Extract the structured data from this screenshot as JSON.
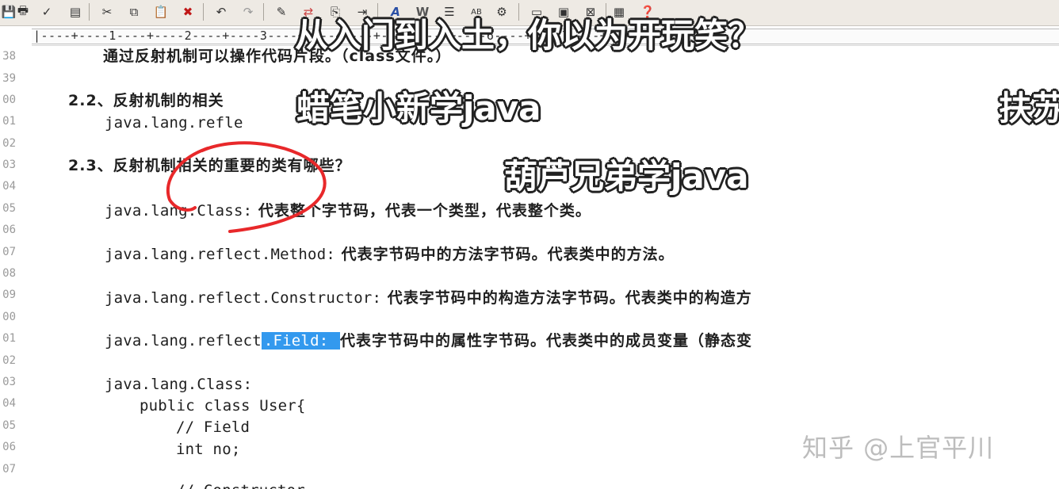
{
  "ruler": {
    "marks": "|----+----1----+----2----+----3----+----4----+----5----+----6----+----7----+----8----+----"
  },
  "line_numbers": [
    "38",
    "39",
    "00",
    "01",
    "02",
    "03",
    "04",
    "05",
    "06",
    "07",
    "08",
    "09",
    "00",
    "01",
    "02",
    "03",
    "04",
    "05",
    "06",
    "07"
  ],
  "document": {
    "line_38": "通过反射机制可以操作代码片段。（class文件。）",
    "line_00": "2.2、反射机制的相关",
    "line_01": "java.lang.refle",
    "line_03": "2.3、反射机制相关的重要的类有哪些？",
    "class_code": "java.lang.Class:",
    "class_desc": " 代表整个字节码，代表一个类型，代表整个类。",
    "method_code": "java.lang.reflect.Method:",
    "method_desc": " 代表字节码中的方法字节码。代表类中的方法。",
    "constructor_code": "java.lang.reflect.Constructor:",
    "constructor_desc": " 代表字节码中的构造方法字节码。代表类中的构造方",
    "field_prefix": "java.lang.reflect",
    "field_selected": ".Field: ",
    "field_desc": "代表字节码中的属性字节码。代表类中的成员变量（静态变",
    "code_1": "java.lang.Class:",
    "code_2": "public class User{",
    "code_3": "// Field",
    "code_4": "int no;",
    "code_5": "// Constructor"
  },
  "overlays": {
    "caption_top": "从入门到入土，你以为开玩笑？",
    "caption_mid": "蜡笔小新学java",
    "caption_right": "扶苏",
    "caption_low": "葫芦兄弟学java",
    "watermark": "知乎 @上官平川"
  },
  "colors": {
    "selection": "#3399ee",
    "annotation": "#e8282a",
    "ruler_cursor": "#1d2b78"
  }
}
